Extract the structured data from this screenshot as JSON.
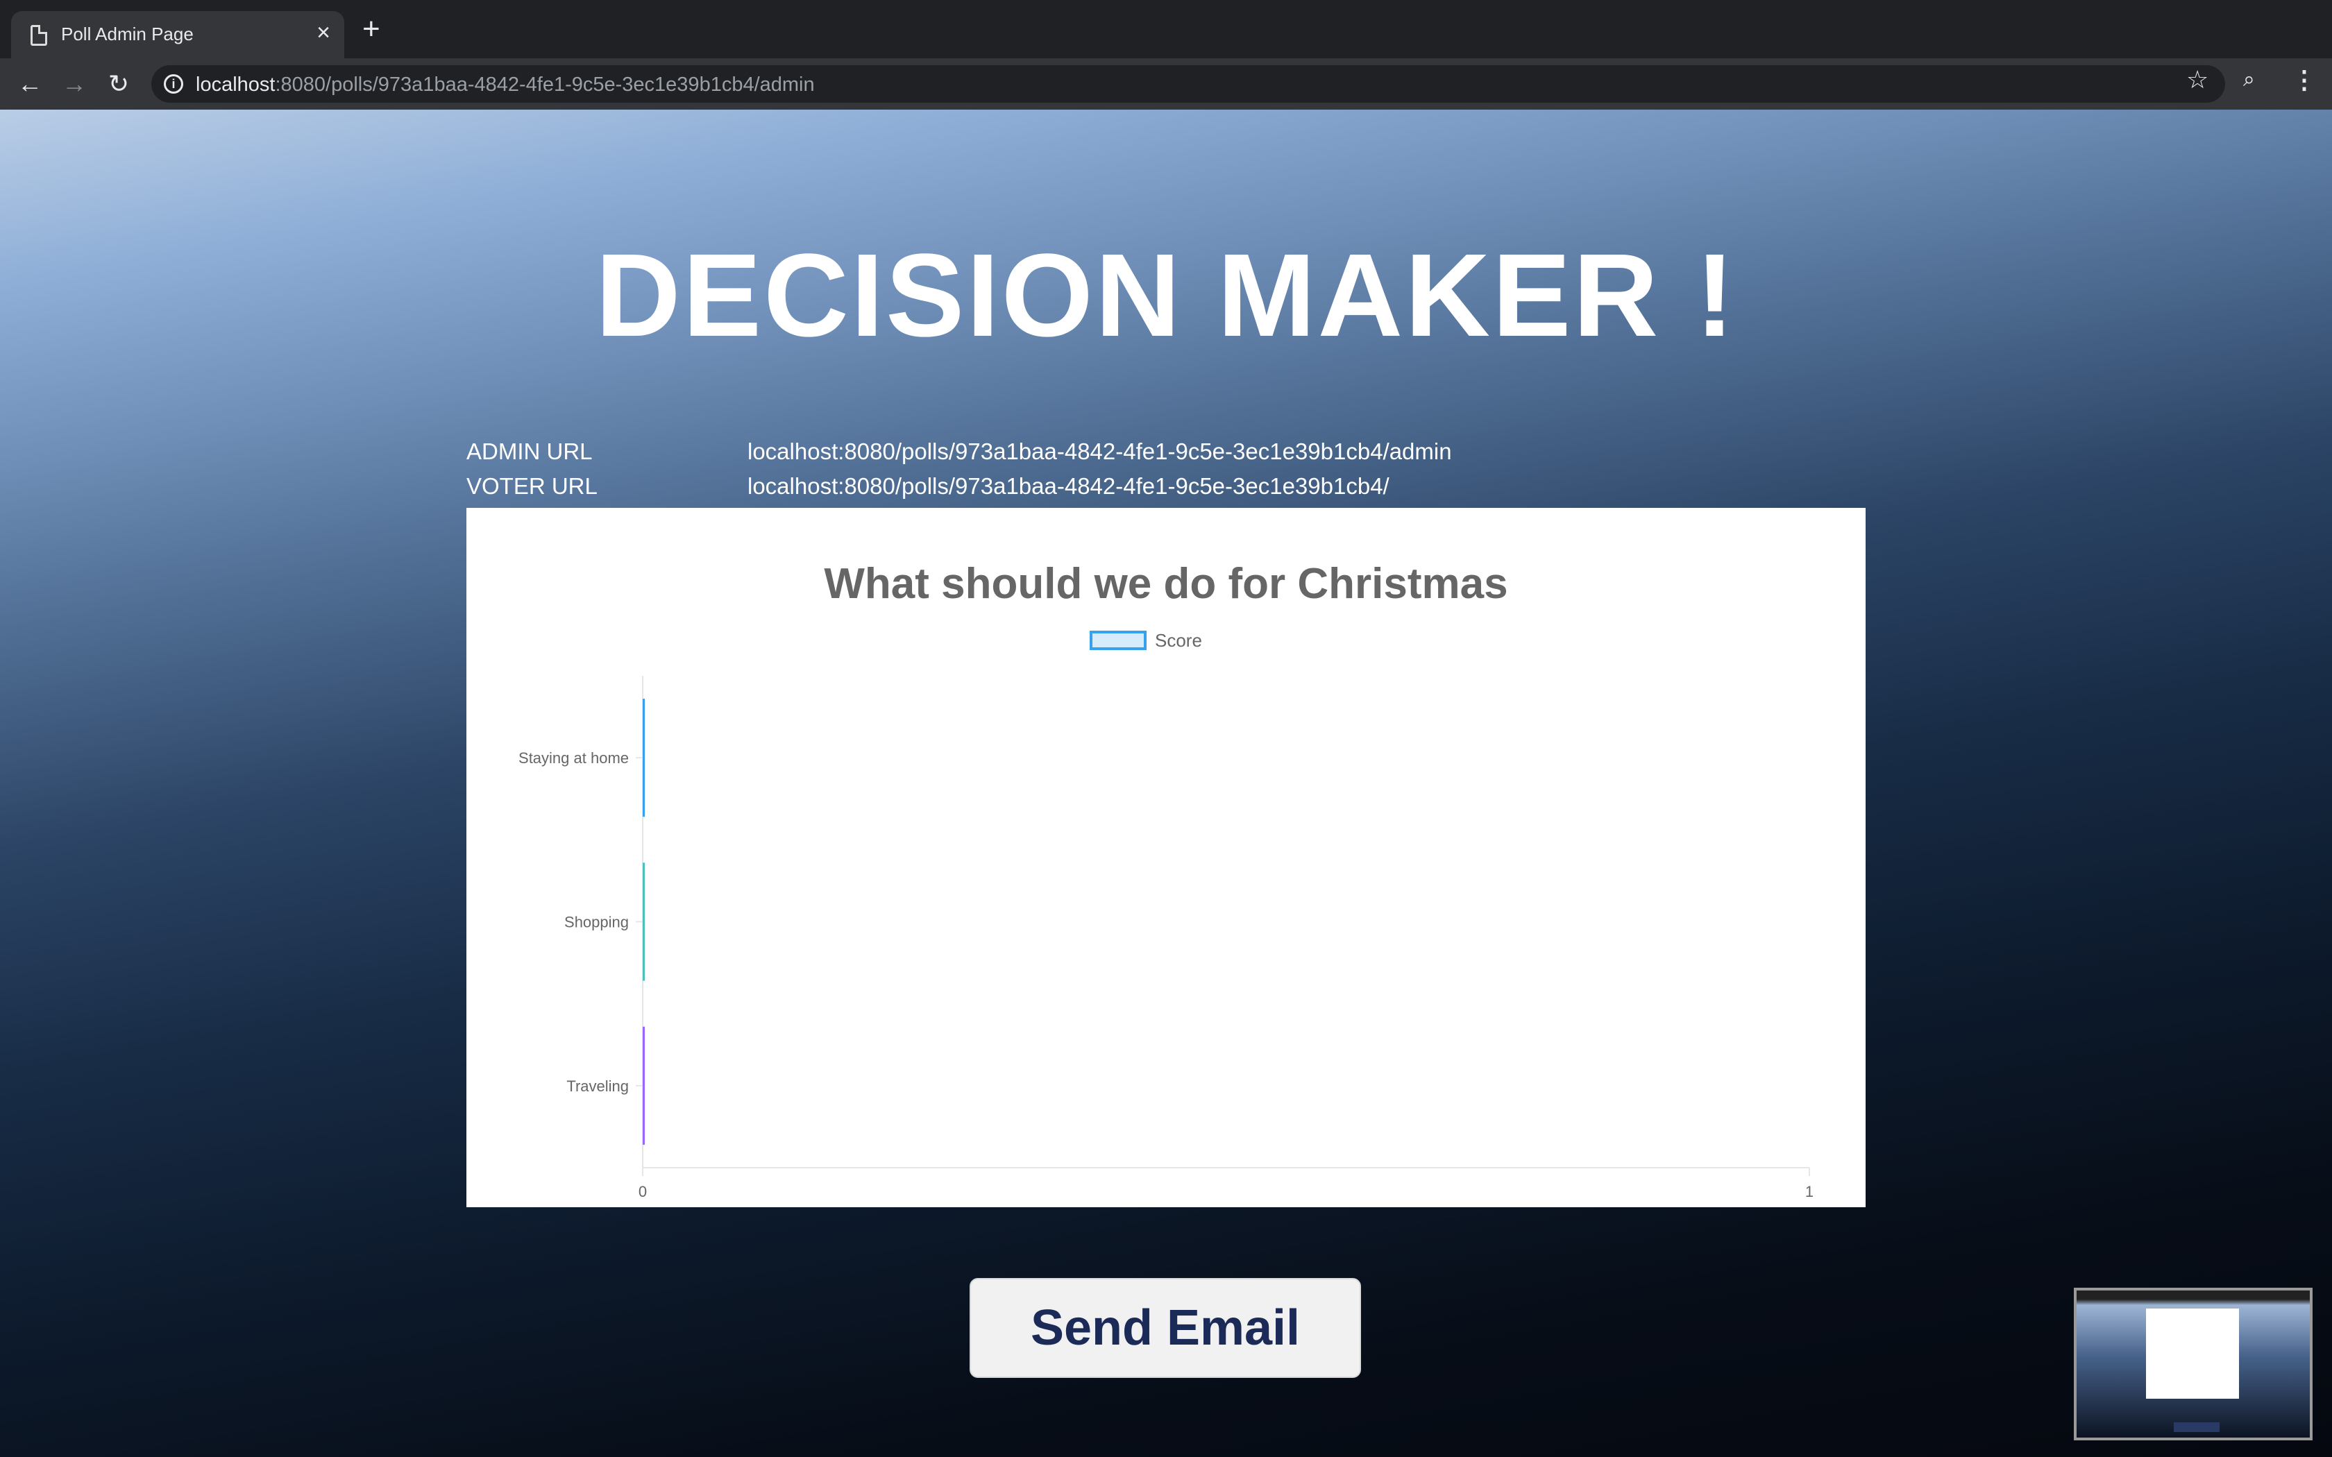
{
  "browser": {
    "tab_title": "Poll Admin Page",
    "tab_close": "×",
    "new_tab": "+",
    "url_host": "localhost",
    "url_path": ":8080/polls/973a1baa-4842-4fe1-9c5e-3ec1e39b1cb4/admin"
  },
  "page": {
    "title": "DECISION MAKER !",
    "admin_label": "ADMIN URL",
    "admin_url": "localhost:8080/polls/973a1baa-4842-4fe1-9c5e-3ec1e39b1cb4/admin",
    "voter_label": "VOTER URL",
    "voter_url": "localhost:8080/polls/973a1baa-4842-4fe1-9c5e-3ec1e39b1cb4/",
    "send_button": "Send Email"
  },
  "chart_data": {
    "type": "bar",
    "orientation": "horizontal",
    "title": "What should we do for Christmas",
    "legend": "top",
    "categories": [
      "Staying at home",
      "Shopping",
      "Traveling"
    ],
    "series": [
      {
        "name": "Score",
        "values": [
          0,
          0,
          0
        ]
      }
    ],
    "bar_colors": [
      "#36a2eb",
      "#4bc0c0",
      "#9966ff"
    ],
    "xlim": [
      0,
      1
    ],
    "x_ticks": [
      "0",
      "1"
    ],
    "grid": false
  }
}
